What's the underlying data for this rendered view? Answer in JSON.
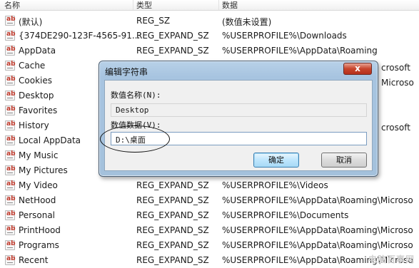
{
  "columns": {
    "name": "名称",
    "type": "类型",
    "data": "数据"
  },
  "rows": [
    {
      "name": "(默认)",
      "type": "REG_SZ",
      "data": "(数值未设置)"
    },
    {
      "name": "{374DE290-123F-4565-91...",
      "type": "REG_EXPAND_SZ",
      "data": "%USERPROFILE%\\Downloads"
    },
    {
      "name": "AppData",
      "type": "REG_EXPAND_SZ",
      "data": "%USERPROFILE%\\AppData\\Roaming"
    },
    {
      "name": "Cache",
      "type": "",
      "data": ""
    },
    {
      "name": "Cookies",
      "type": "",
      "data": ""
    },
    {
      "name": "Desktop",
      "type": "",
      "data": ""
    },
    {
      "name": "Favorites",
      "type": "",
      "data": ""
    },
    {
      "name": "History",
      "type": "",
      "data": ""
    },
    {
      "name": "Local AppData",
      "type": "",
      "data": ""
    },
    {
      "name": "My Music",
      "type": "",
      "data": ""
    },
    {
      "name": "My Pictures",
      "type": "",
      "data": ""
    },
    {
      "name": "My Video",
      "type": "REG_EXPAND_SZ",
      "data": "%USERPROFILE%\\Videos"
    },
    {
      "name": "NetHood",
      "type": "REG_EXPAND_SZ",
      "data": "%USERPROFILE%\\AppData\\Roaming\\Microso"
    },
    {
      "name": "Personal",
      "type": "REG_EXPAND_SZ",
      "data": "%USERPROFILE%\\Documents"
    },
    {
      "name": "PrintHood",
      "type": "REG_EXPAND_SZ",
      "data": "%USERPROFILE%\\AppData\\Roaming\\Microso"
    },
    {
      "name": "Programs",
      "type": "REG_EXPAND_SZ",
      "data": "%USERPROFILE%\\AppData\\Roaming\\Microso"
    },
    {
      "name": "Recent",
      "type": "REG_EXPAND_SZ",
      "data": "%USERPROFILE%\\AppData\\Roaming\\Microso"
    }
  ],
  "behind_fragments": [
    "crosoft",
    "Microso",
    "crosoft"
  ],
  "dialog": {
    "title": "编辑字符串",
    "close_label": "x",
    "value_name_label": "数值名称(N):",
    "value_name": "Desktop",
    "value_data_label": "数值数据(V):",
    "value_data": "D:\\桌面",
    "ok_label": "确定",
    "cancel_label": "取消"
  },
  "watermark": "电脑百事网"
}
